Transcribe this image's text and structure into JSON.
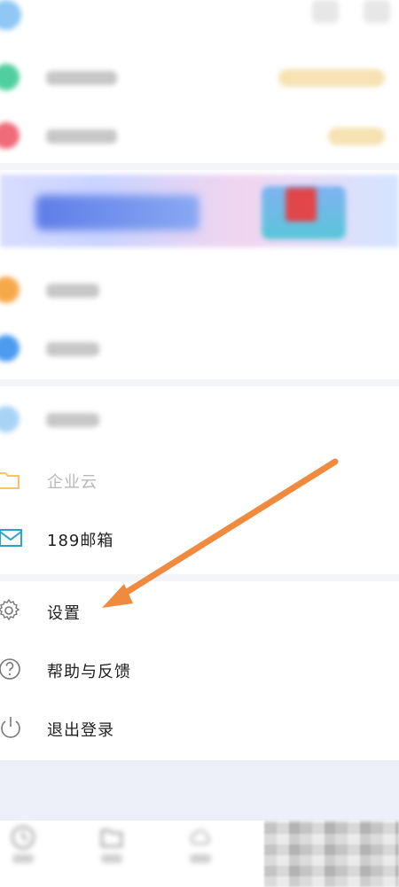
{
  "header": {
    "buttons": [
      "scan-icon",
      "message-icon"
    ]
  },
  "menu": {
    "items": [
      {
        "name": "blurred-item-green",
        "color": "#4fcf9f"
      },
      {
        "name": "blurred-item-red",
        "color": "#f06b7a"
      },
      {
        "name": "blurred-item-orange",
        "color": "#f7a94a"
      },
      {
        "name": "blurred-item-blue",
        "color": "#4c9bf0"
      },
      {
        "name": "blurred-item-lightblue",
        "color": "#a9d3f5"
      },
      {
        "label": "企业云",
        "icon": "folder-icon",
        "color": "#f3c46a"
      },
      {
        "label": "189邮箱",
        "icon": "mail-icon",
        "color": "#2aa3c7"
      },
      {
        "label": "设置",
        "icon": "gear-icon"
      },
      {
        "label": "帮助与反馈",
        "icon": "help-icon"
      },
      {
        "label": "退出登录",
        "icon": "power-icon"
      }
    ]
  },
  "tabbar": {
    "icons": [
      "clock-icon",
      "file-icon",
      "cloud-icon"
    ]
  },
  "colors": {
    "arrow": "#ef8a3f",
    "separator": "#f4f5f9",
    "bottom_bg": "#eef0f9"
  }
}
